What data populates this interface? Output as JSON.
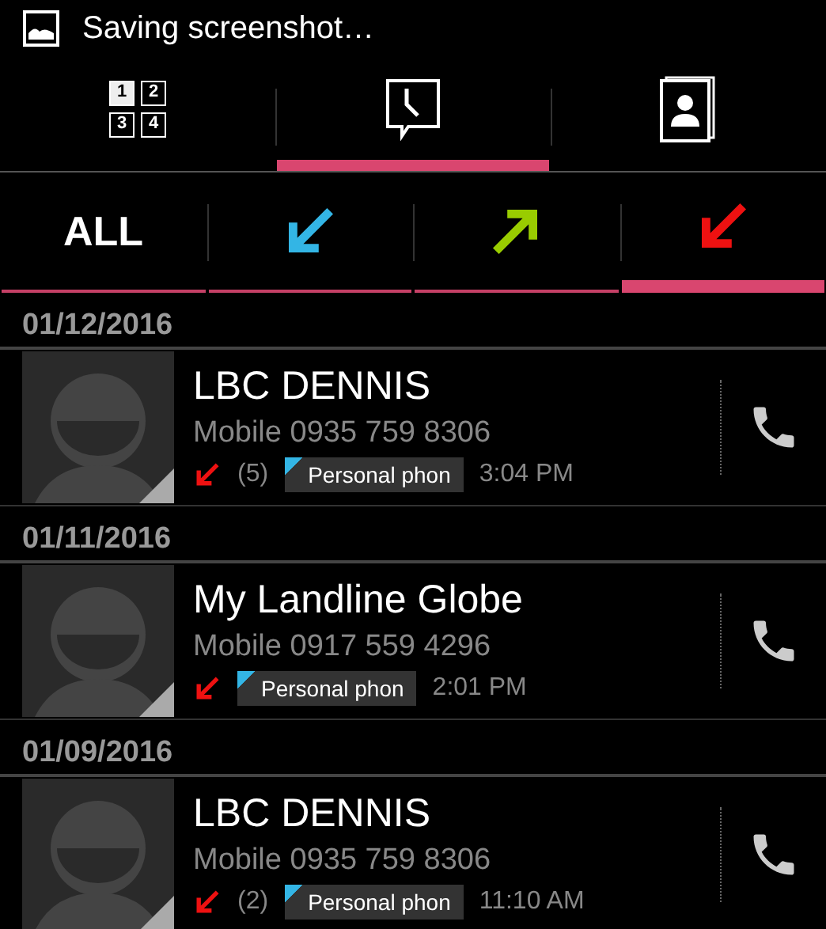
{
  "status_bar": {
    "text": "Saving screenshot…"
  },
  "tabs": [
    {
      "kind": "dialpad",
      "labels": [
        "1",
        "2",
        "3",
        "4"
      ],
      "selected": false
    },
    {
      "kind": "recent",
      "selected": true
    },
    {
      "kind": "contacts",
      "selected": false
    }
  ],
  "filters": [
    {
      "kind": "all",
      "label": "ALL",
      "selected": false
    },
    {
      "kind": "incoming",
      "selected": false
    },
    {
      "kind": "outgoing",
      "selected": false
    },
    {
      "kind": "missed",
      "selected": true
    }
  ],
  "sections": [
    {
      "date": "01/12/2016",
      "calls": [
        {
          "name": "LBC DENNIS",
          "number": "Mobile 0935 759 8306",
          "kind": "missed",
          "count": "(5)",
          "tag": "Personal phon",
          "time": "3:04 PM"
        }
      ]
    },
    {
      "date": "01/11/2016",
      "calls": [
        {
          "name": "My Landline Globe",
          "number": "Mobile 0917 559 4296",
          "kind": "missed",
          "tag": "Personal phon",
          "time": "2:01 PM"
        }
      ]
    },
    {
      "date": "01/09/2016",
      "calls": [
        {
          "name": "LBC DENNIS",
          "number": "Mobile 0935 759 8306",
          "kind": "missed",
          "count": "(2)",
          "tag": "Personal phon",
          "time": "11:10 AM"
        }
      ]
    }
  ]
}
